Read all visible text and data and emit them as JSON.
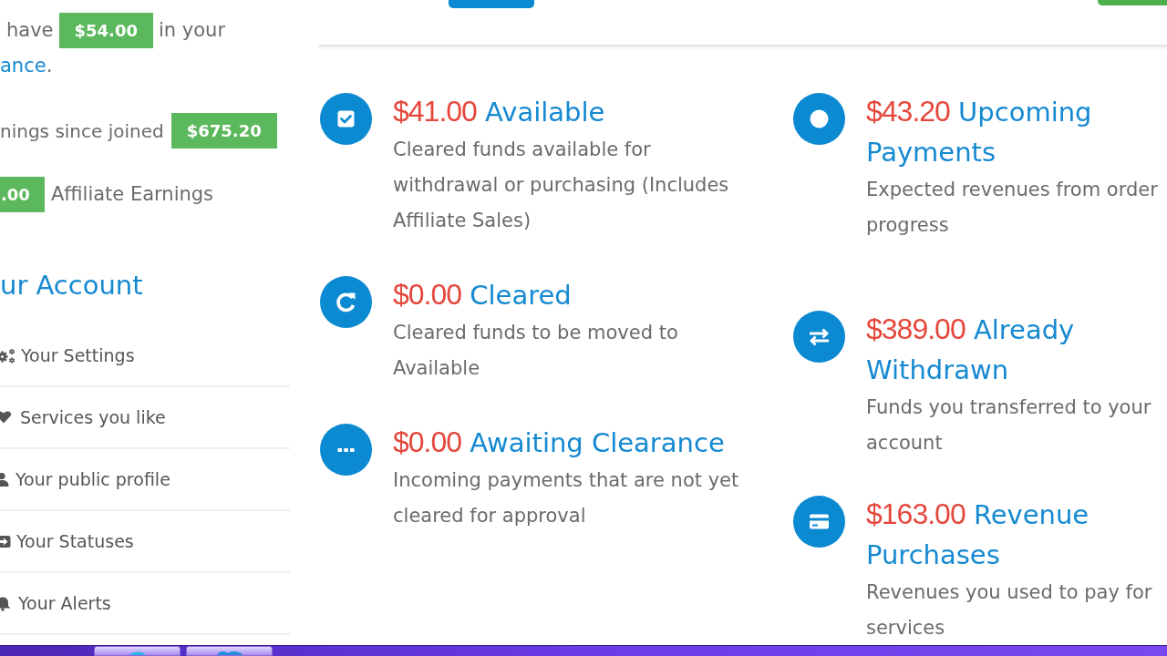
{
  "sidebar": {
    "balance": {
      "before": "have",
      "amount": "$54.00",
      "after": "in your",
      "link": "ance",
      "link_suffix": "."
    },
    "earnings": {
      "label": "nings since joined",
      "amount": "$675.20"
    },
    "affiliate": {
      "amount": ".00",
      "label": "Affiliate Earnings"
    },
    "heading": "ur Account",
    "menu": [
      {
        "label": "Your Settings"
      },
      {
        "label": "Services you like"
      },
      {
        "label": "Your public profile"
      },
      {
        "label": "Your Statuses"
      },
      {
        "label": "Your Alerts"
      }
    ]
  },
  "summary": {
    "left": [
      {
        "amount": "$41.00",
        "title": "Available",
        "description": "Cleared funds available for withdrawal or purchasing (Includes Affiliate Sales)"
      },
      {
        "amount": "$0.00",
        "title": "Cleared",
        "description": "Cleared funds to be moved to Available"
      },
      {
        "amount": "$0.00",
        "title": "Awaiting Clearance",
        "description": "Incoming payments that are not yet cleared for approval"
      }
    ],
    "right": [
      {
        "amount": "$43.20",
        "title": "Upcoming Payments",
        "description": "Expected revenues from order\nprogress"
      },
      {
        "amount": "$389.00",
        "title": "Already Withdrawn",
        "description": "Funds you transferred to your\naccount"
      },
      {
        "amount": "$163.00",
        "title": "Revenue Purchases",
        "description": "Revenues you used to pay for\nservices"
      }
    ]
  }
}
